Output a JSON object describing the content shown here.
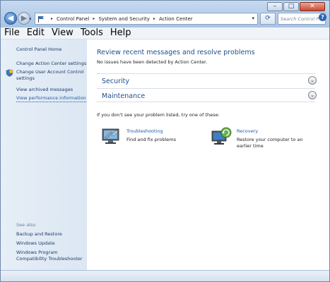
{
  "window": {
    "minimize_glyph": "–",
    "maximize_glyph": "□",
    "close_glyph": "✕"
  },
  "nav": {
    "back_glyph": "◀",
    "forward_glyph": "▶",
    "recent_glyph": "▾",
    "refresh_glyph": "⟳"
  },
  "address": {
    "crumbs": [
      "Control Panel",
      "System and Security",
      "Action Center"
    ],
    "separator": "▸",
    "dropdown_glyph": "▾"
  },
  "search": {
    "placeholder": "Search Control P...",
    "icon": "search-icon"
  },
  "menubar": {
    "items": [
      "File",
      "Edit",
      "View",
      "Tools",
      "Help"
    ]
  },
  "help_glyph": "?",
  "sidebar": {
    "home": "Control Panel Home",
    "links": [
      "Change Action Center settings",
      "Change User Account Control",
      "settings",
      "View archived messages",
      "View performance information"
    ],
    "see_also_heading": "See also",
    "see_also": [
      "Backup and Restore",
      "Windows Update",
      "Windows Program",
      "Compatibility Troubleshooter"
    ]
  },
  "main": {
    "title": "Review recent messages and resolve problems",
    "no_issues": "No issues have been detected by Action Center.",
    "sections": [
      {
        "label": "Security",
        "chevron": "⌄"
      },
      {
        "label": "Maintenance",
        "chevron": "⌄"
      }
    ],
    "try_one": "If you don't see your problem listed, try one of these:",
    "tools": [
      {
        "title": "Troubleshooting",
        "desc": [
          "Find and fix problems"
        ]
      },
      {
        "title": "Recovery",
        "desc": [
          "Restore your computer to an",
          "earlier time"
        ]
      }
    ]
  },
  "colors": {
    "accent": "#1d4e8f",
    "link": "#1f5ba8",
    "sidebar_bg": "#e1eaf5"
  }
}
